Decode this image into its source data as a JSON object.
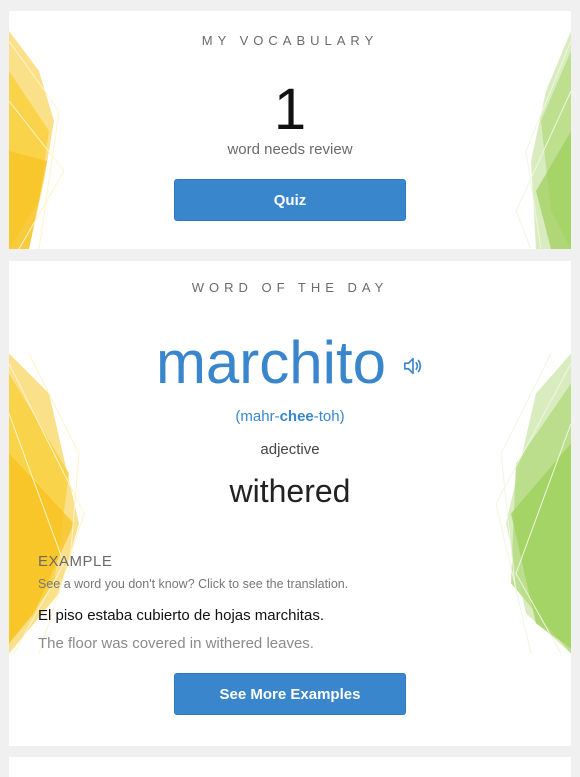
{
  "vocabulary": {
    "heading": "MY VOCABULARY",
    "count": "1",
    "review_text": "word needs review",
    "quiz_label": "Quiz"
  },
  "word_of_day": {
    "heading": "WORD OF THE DAY",
    "word": "marchito",
    "pron_pre": "(mahr-",
    "pron_stress": "chee",
    "pron_post": "-toh)",
    "part_of_speech": "adjective",
    "translation": "withered",
    "example_label": "EXAMPLE",
    "example_hint": "See a word you don't know? Click to see the translation.",
    "example_sentence": "El piso estaba cubierto de hojas marchitas.",
    "example_translation": "The floor was covered in withered leaves.",
    "see_more_label": "See More Examples"
  },
  "colors": {
    "accent": "#3a86cc",
    "background": "#f0f0f0",
    "yellow_decor": "#f9cf3a",
    "green_decor": "#9ccf5a"
  },
  "icons": {
    "speaker": "speaker-icon"
  }
}
